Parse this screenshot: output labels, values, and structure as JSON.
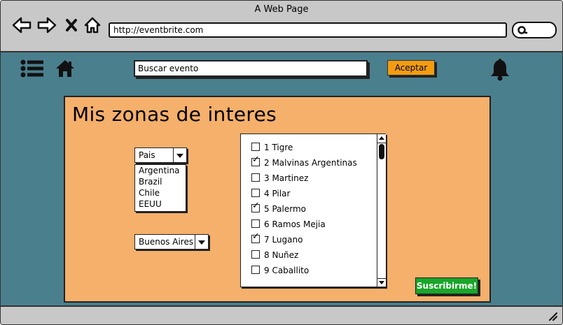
{
  "window": {
    "title": "A Web Page"
  },
  "browser": {
    "url": "http://eventbrite.com",
    "icons": [
      "back-arrow-icon",
      "forward-arrow-icon",
      "close-icon",
      "home-icon",
      "search-icon"
    ]
  },
  "header": {
    "search_value": "Buscar evento",
    "accept_label": "Aceptar",
    "icons": [
      "menu-icon",
      "home-icon",
      "bell-icon"
    ]
  },
  "panel": {
    "title": "Mis zonas de interes",
    "country_select": {
      "value": "Pais",
      "options": [
        "Argentina",
        "Brazil",
        "Chile",
        "EEUU"
      ]
    },
    "province_select": {
      "value": "Buenos Aires"
    },
    "zones": [
      {
        "label": "1 Tigre",
        "checked": false
      },
      {
        "label": "2 Malvinas Argentinas",
        "checked": true
      },
      {
        "label": "3 Martinez",
        "checked": false
      },
      {
        "label": "4 Pilar",
        "checked": false
      },
      {
        "label": "5 Palermo",
        "checked": true
      },
      {
        "label": "6 Ramos Mejia",
        "checked": false
      },
      {
        "label": "7 Lugano",
        "checked": true
      },
      {
        "label": "8 Nuñez",
        "checked": false
      },
      {
        "label": "9 Caballito",
        "checked": false
      }
    ],
    "subscribe_label": "Suscribirme!"
  },
  "colors": {
    "content_bg": "#4a7f8e",
    "panel_bg": "#f5b06b",
    "accept_button": "#f39c12",
    "subscribe_button": "#1aa52a",
    "chrome_bg": "#c8c8c8"
  }
}
